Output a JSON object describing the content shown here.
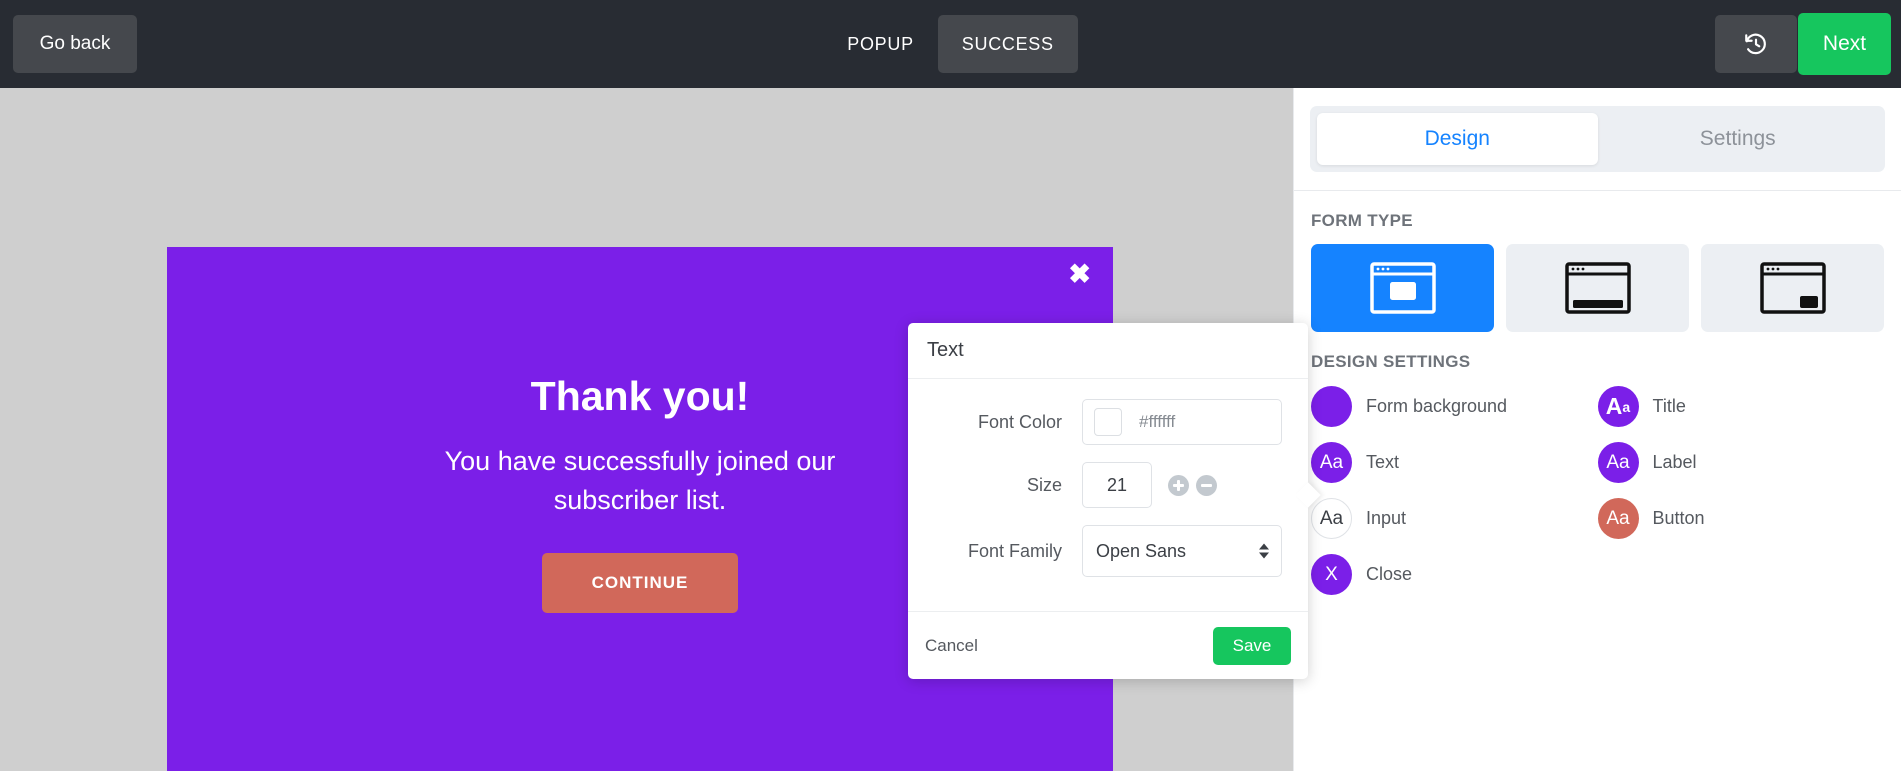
{
  "topbar": {
    "go_back_label": "Go back",
    "steps": [
      {
        "label": "POPUP",
        "active": false
      },
      {
        "label": "SUCCESS",
        "active": true
      }
    ],
    "history_icon": "history-undo-icon",
    "next_label": "Next",
    "colors": {
      "bar_bg": "#282c33",
      "button_bg": "#45484d",
      "next_bg": "#16c65e"
    }
  },
  "canvas": {
    "background": "#cfcfcf",
    "form": {
      "background": "#7b1fe8",
      "close_icon": "✖",
      "title": "Thank you!",
      "text": "You have successfully joined our subscriber list.",
      "button_label": "CONTINUE",
      "button_color": "#d1685a",
      "text_color": "#ffffff"
    }
  },
  "dialog": {
    "title": "Text",
    "fields": {
      "font_color_label": "Font Color",
      "font_color_value": "#ffffff",
      "size_label": "Size",
      "size_value": "21",
      "increase_icon": "plus-circle-icon",
      "decrease_icon": "minus-circle-icon",
      "font_family_label": "Font Family",
      "font_family_value": "Open Sans",
      "font_family_options": [
        "Open Sans"
      ]
    },
    "cancel_label": "Cancel",
    "save_label": "Save",
    "save_color": "#16c65e"
  },
  "panel": {
    "tabs": [
      {
        "label": "Design",
        "active": true
      },
      {
        "label": "Settings",
        "active": false
      }
    ],
    "active_tab_color": "#1583ff",
    "form_type": {
      "title": "FORM TYPE",
      "options": [
        {
          "icon": "popup-layout-icon",
          "active": true
        },
        {
          "icon": "floating-bar-layout-icon",
          "active": false
        },
        {
          "icon": "slide-in-layout-icon",
          "active": false
        }
      ]
    },
    "design_settings": {
      "title": "DESIGN SETTINGS",
      "items": [
        {
          "label": "Form background",
          "icon": "form-background-swatch-icon",
          "glyph": "",
          "color": "#7b1fe8",
          "style": "solid"
        },
        {
          "label": "Title",
          "icon": "title-typography-icon",
          "glyph": "Aa",
          "color": "#7b1fe8",
          "style": "title"
        },
        {
          "label": "Text",
          "icon": "text-typography-icon",
          "glyph": "Aa",
          "color": "#7b1fe8",
          "style": "solid"
        },
        {
          "label": "Label",
          "icon": "label-typography-icon",
          "glyph": "Aa",
          "color": "#7b1fe8",
          "style": "solid"
        },
        {
          "label": "Input",
          "icon": "input-typography-icon",
          "glyph": "Aa",
          "color": "#ffffff",
          "style": "outline"
        },
        {
          "label": "Button",
          "icon": "button-typography-icon",
          "glyph": "Aa",
          "color": "#d1685a",
          "style": "solid"
        },
        {
          "label": "Close",
          "icon": "close-style-icon",
          "glyph": "X",
          "color": "#7b1fe8",
          "style": "solid"
        }
      ]
    }
  }
}
